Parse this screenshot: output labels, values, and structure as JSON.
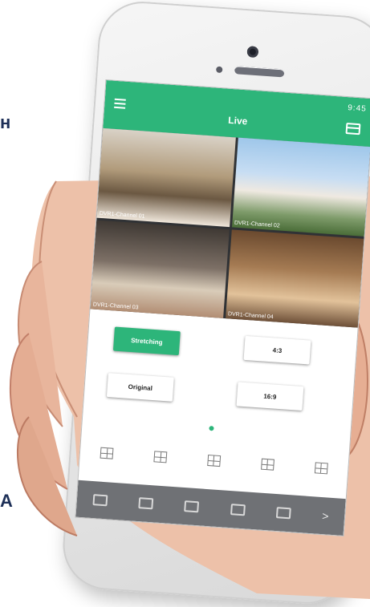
{
  "status_bar": {
    "time": "9:45"
  },
  "app_bar": {
    "title": "Live"
  },
  "channels": [
    {
      "label": "DVR1-Channel 01"
    },
    {
      "label": "DVR1-Channel 02"
    },
    {
      "label": "DVR1-Channel 03"
    },
    {
      "label": "DVR1-Channel 04"
    }
  ],
  "display_modes": {
    "stretching": "Stretching",
    "ratio_4_3": "4:3",
    "original": "Original",
    "ratio_16_9": "16:9"
  },
  "pager": {
    "active_page": 1
  },
  "layout_icons": [
    "grid-4-icon",
    "grid-6-icon",
    "grid-8-icon",
    "grid-9-icon",
    "grid-16-icon"
  ],
  "toolbar": {
    "icons": [
      "camera-icon",
      "record-icon",
      "ptz-icon",
      "playback-icon",
      "cast-icon",
      "next-icon"
    ],
    "next_label": ">"
  },
  "colors": {
    "accent": "#2db57a",
    "toolbar": "#6f7175"
  }
}
